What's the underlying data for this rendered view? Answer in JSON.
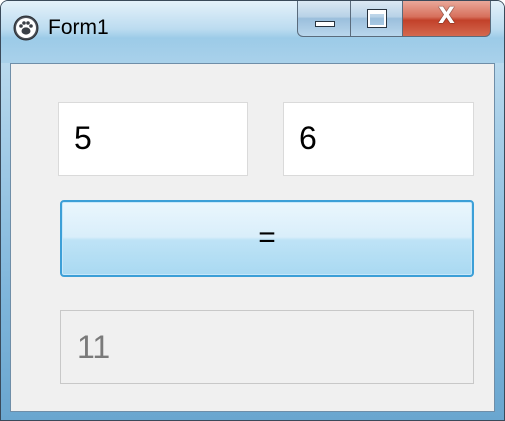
{
  "window": {
    "title": "Form1",
    "icon": "paw-icon",
    "caption_buttons": {
      "minimize": "minimize-icon",
      "maximize": "maximize-icon",
      "close": "X"
    }
  },
  "form": {
    "input_a_value": "5",
    "input_b_value": "6",
    "equals_label": "=",
    "result_value": "11"
  },
  "colors": {
    "button_border": "#3c9fd7",
    "close_button": "#c2412a",
    "client_background": "#f0f0f0",
    "result_text": "#7a7a7a"
  }
}
